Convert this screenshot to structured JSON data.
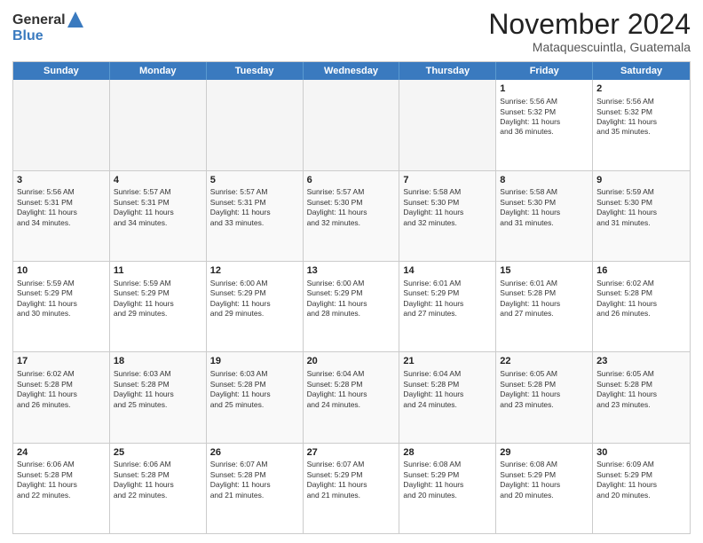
{
  "logo": {
    "general": "General",
    "blue": "Blue"
  },
  "title": "November 2024",
  "location": "Mataquescuintla, Guatemala",
  "header_days": [
    "Sunday",
    "Monday",
    "Tuesday",
    "Wednesday",
    "Thursday",
    "Friday",
    "Saturday"
  ],
  "rows": [
    [
      {
        "day": "",
        "text": "",
        "empty": true
      },
      {
        "day": "",
        "text": "",
        "empty": true
      },
      {
        "day": "",
        "text": "",
        "empty": true
      },
      {
        "day": "",
        "text": "",
        "empty": true
      },
      {
        "day": "",
        "text": "",
        "empty": true
      },
      {
        "day": "1",
        "text": "Sunrise: 5:56 AM\nSunset: 5:32 PM\nDaylight: 11 hours\nand 36 minutes.",
        "empty": false
      },
      {
        "day": "2",
        "text": "Sunrise: 5:56 AM\nSunset: 5:32 PM\nDaylight: 11 hours\nand 35 minutes.",
        "empty": false
      }
    ],
    [
      {
        "day": "3",
        "text": "Sunrise: 5:56 AM\nSunset: 5:31 PM\nDaylight: 11 hours\nand 34 minutes.",
        "empty": false
      },
      {
        "day": "4",
        "text": "Sunrise: 5:57 AM\nSunset: 5:31 PM\nDaylight: 11 hours\nand 34 minutes.",
        "empty": false
      },
      {
        "day": "5",
        "text": "Sunrise: 5:57 AM\nSunset: 5:31 PM\nDaylight: 11 hours\nand 33 minutes.",
        "empty": false
      },
      {
        "day": "6",
        "text": "Sunrise: 5:57 AM\nSunset: 5:30 PM\nDaylight: 11 hours\nand 32 minutes.",
        "empty": false
      },
      {
        "day": "7",
        "text": "Sunrise: 5:58 AM\nSunset: 5:30 PM\nDaylight: 11 hours\nand 32 minutes.",
        "empty": false
      },
      {
        "day": "8",
        "text": "Sunrise: 5:58 AM\nSunset: 5:30 PM\nDaylight: 11 hours\nand 31 minutes.",
        "empty": false
      },
      {
        "day": "9",
        "text": "Sunrise: 5:59 AM\nSunset: 5:30 PM\nDaylight: 11 hours\nand 31 minutes.",
        "empty": false
      }
    ],
    [
      {
        "day": "10",
        "text": "Sunrise: 5:59 AM\nSunset: 5:29 PM\nDaylight: 11 hours\nand 30 minutes.",
        "empty": false
      },
      {
        "day": "11",
        "text": "Sunrise: 5:59 AM\nSunset: 5:29 PM\nDaylight: 11 hours\nand 29 minutes.",
        "empty": false
      },
      {
        "day": "12",
        "text": "Sunrise: 6:00 AM\nSunset: 5:29 PM\nDaylight: 11 hours\nand 29 minutes.",
        "empty": false
      },
      {
        "day": "13",
        "text": "Sunrise: 6:00 AM\nSunset: 5:29 PM\nDaylight: 11 hours\nand 28 minutes.",
        "empty": false
      },
      {
        "day": "14",
        "text": "Sunrise: 6:01 AM\nSunset: 5:29 PM\nDaylight: 11 hours\nand 27 minutes.",
        "empty": false
      },
      {
        "day": "15",
        "text": "Sunrise: 6:01 AM\nSunset: 5:28 PM\nDaylight: 11 hours\nand 27 minutes.",
        "empty": false
      },
      {
        "day": "16",
        "text": "Sunrise: 6:02 AM\nSunset: 5:28 PM\nDaylight: 11 hours\nand 26 minutes.",
        "empty": false
      }
    ],
    [
      {
        "day": "17",
        "text": "Sunrise: 6:02 AM\nSunset: 5:28 PM\nDaylight: 11 hours\nand 26 minutes.",
        "empty": false
      },
      {
        "day": "18",
        "text": "Sunrise: 6:03 AM\nSunset: 5:28 PM\nDaylight: 11 hours\nand 25 minutes.",
        "empty": false
      },
      {
        "day": "19",
        "text": "Sunrise: 6:03 AM\nSunset: 5:28 PM\nDaylight: 11 hours\nand 25 minutes.",
        "empty": false
      },
      {
        "day": "20",
        "text": "Sunrise: 6:04 AM\nSunset: 5:28 PM\nDaylight: 11 hours\nand 24 minutes.",
        "empty": false
      },
      {
        "day": "21",
        "text": "Sunrise: 6:04 AM\nSunset: 5:28 PM\nDaylight: 11 hours\nand 24 minutes.",
        "empty": false
      },
      {
        "day": "22",
        "text": "Sunrise: 6:05 AM\nSunset: 5:28 PM\nDaylight: 11 hours\nand 23 minutes.",
        "empty": false
      },
      {
        "day": "23",
        "text": "Sunrise: 6:05 AM\nSunset: 5:28 PM\nDaylight: 11 hours\nand 23 minutes.",
        "empty": false
      }
    ],
    [
      {
        "day": "24",
        "text": "Sunrise: 6:06 AM\nSunset: 5:28 PM\nDaylight: 11 hours\nand 22 minutes.",
        "empty": false
      },
      {
        "day": "25",
        "text": "Sunrise: 6:06 AM\nSunset: 5:28 PM\nDaylight: 11 hours\nand 22 minutes.",
        "empty": false
      },
      {
        "day": "26",
        "text": "Sunrise: 6:07 AM\nSunset: 5:28 PM\nDaylight: 11 hours\nand 21 minutes.",
        "empty": false
      },
      {
        "day": "27",
        "text": "Sunrise: 6:07 AM\nSunset: 5:29 PM\nDaylight: 11 hours\nand 21 minutes.",
        "empty": false
      },
      {
        "day": "28",
        "text": "Sunrise: 6:08 AM\nSunset: 5:29 PM\nDaylight: 11 hours\nand 20 minutes.",
        "empty": false
      },
      {
        "day": "29",
        "text": "Sunrise: 6:08 AM\nSunset: 5:29 PM\nDaylight: 11 hours\nand 20 minutes.",
        "empty": false
      },
      {
        "day": "30",
        "text": "Sunrise: 6:09 AM\nSunset: 5:29 PM\nDaylight: 11 hours\nand 20 minutes.",
        "empty": false
      }
    ]
  ]
}
